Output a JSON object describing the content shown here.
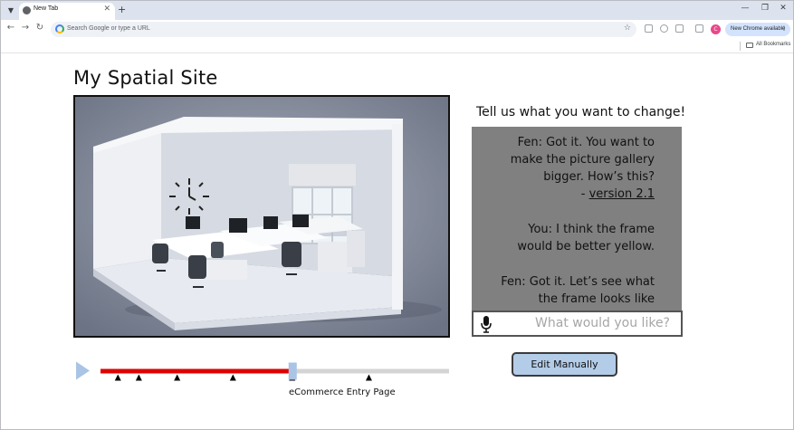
{
  "browser": {
    "tab_title": "New Tab",
    "omnibox_placeholder": "Search Google or type a URL",
    "new_chrome_label": "New Chrome available",
    "profile_initial": "C",
    "bookmarks_label": "All Bookmarks"
  },
  "page": {
    "title": "My Spatial Site",
    "change_heading": "Tell us what you want to change!",
    "chat": [
      {
        "speaker": "Fen",
        "lines": [
          "Fen: Got it. You want to",
          "make the picture gallery",
          "bigger.  How’s this?"
        ],
        "link_prefix": "- ",
        "link_text": "version 2.1"
      },
      {
        "speaker": "You",
        "lines": [
          "You: I think the frame",
          "would be better yellow."
        ]
      },
      {
        "speaker": "Fen",
        "lines": [
          "Fen: Got it. Let’s see what",
          "the frame looks like"
        ]
      }
    ],
    "prompt_placeholder": "What would you like?",
    "edit_button_label": "Edit Manually",
    "timeline": {
      "progress_fraction": 0.55,
      "marker_fractions": [
        0.05,
        0.11,
        0.22,
        0.38,
        0.55,
        0.77
      ],
      "current_label": "eCommerce Entry Page",
      "played_color": "#e00000",
      "track_color": "#d4d4d4",
      "handle_color": "#a9c4e4",
      "play_color": "#a9c4e4"
    }
  }
}
